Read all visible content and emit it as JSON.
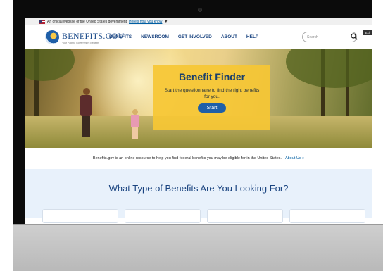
{
  "gov_banner": {
    "text": "An official website of the United States government",
    "link": "Here's how you know"
  },
  "header": {
    "logo_name": "BENEFITS.GOV",
    "logo_tagline": "Your Path to Government Benefits",
    "nav": [
      "BENEFITS",
      "NEWSROOM",
      "GET INVOLVED",
      "ABOUT",
      "HELP"
    ],
    "search_placeholder": "Search",
    "exit_label": "Exit"
  },
  "hero": {
    "title": "Benefit Finder",
    "text": "Start the questionnaire to find the right benefits for you.",
    "button": "Start"
  },
  "info_bar": {
    "text": "Benefits.gov is an online resource to help you find federal benefits you may be eligible for in the United States.",
    "link": "About Us »"
  },
  "benefits_section": {
    "heading": "What Type of Benefits Are You Looking For?"
  },
  "colors": {
    "brand_blue": "#1a4480",
    "finder_yellow": "#f6c734",
    "button_blue": "#1f5fa8",
    "section_bg": "#e8f1fb"
  }
}
